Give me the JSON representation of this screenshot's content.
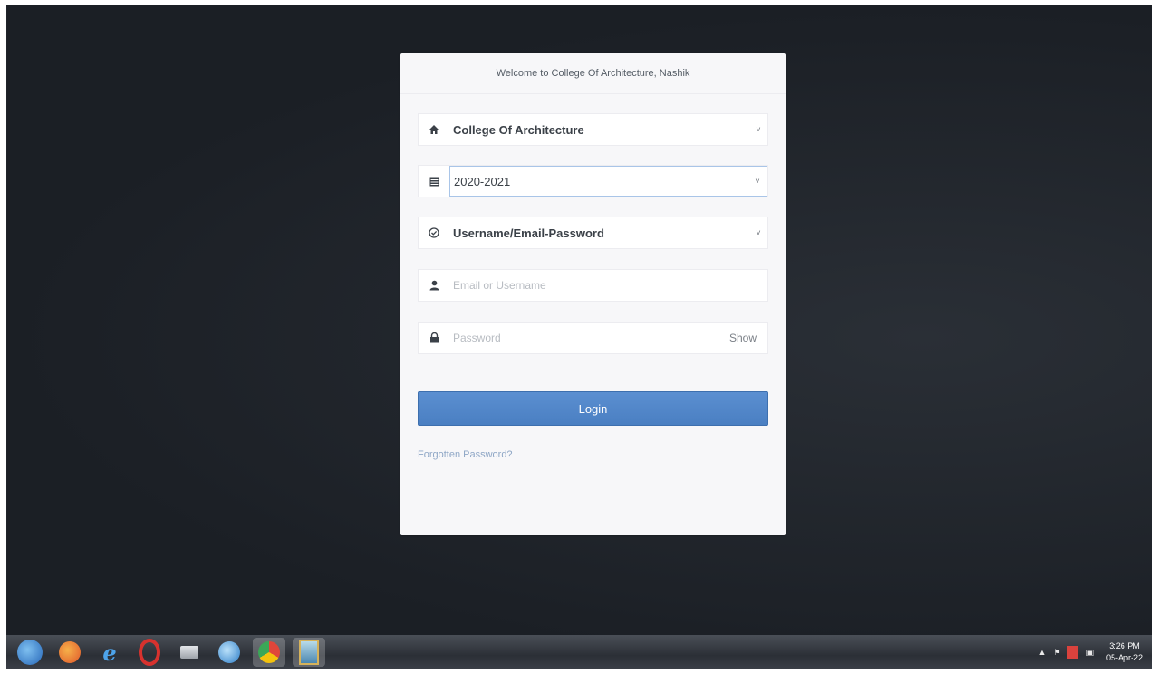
{
  "login": {
    "header": "Welcome to College Of Architecture, Nashik",
    "college_select": "College Of Architecture",
    "year_select": "2020-2021",
    "method_select": "Username/Email-Password",
    "username_placeholder": "Email or Username",
    "password_placeholder": "Password",
    "show_label": "Show",
    "login_label": "Login",
    "forgot_label": "Forgotten Password?"
  },
  "taskbar": {
    "apps": [
      {
        "name": "start-button-icon",
        "color": "#3a7fd0"
      },
      {
        "name": "firefox-icon",
        "color": "#e8742a"
      },
      {
        "name": "internet-explorer-icon",
        "color": "#3b8fe0"
      },
      {
        "name": "opera-icon",
        "color": "#d8322e"
      },
      {
        "name": "printer-icon",
        "color": "#c9ccd1"
      },
      {
        "name": "network-globe-icon",
        "color": "#4a9ad8"
      },
      {
        "name": "chrome-icon",
        "color": "#e0463a"
      },
      {
        "name": "app-portrait-icon",
        "color": "#6aa6c9"
      }
    ],
    "time": "3:26 PM",
    "date": "05-Apr-22"
  }
}
